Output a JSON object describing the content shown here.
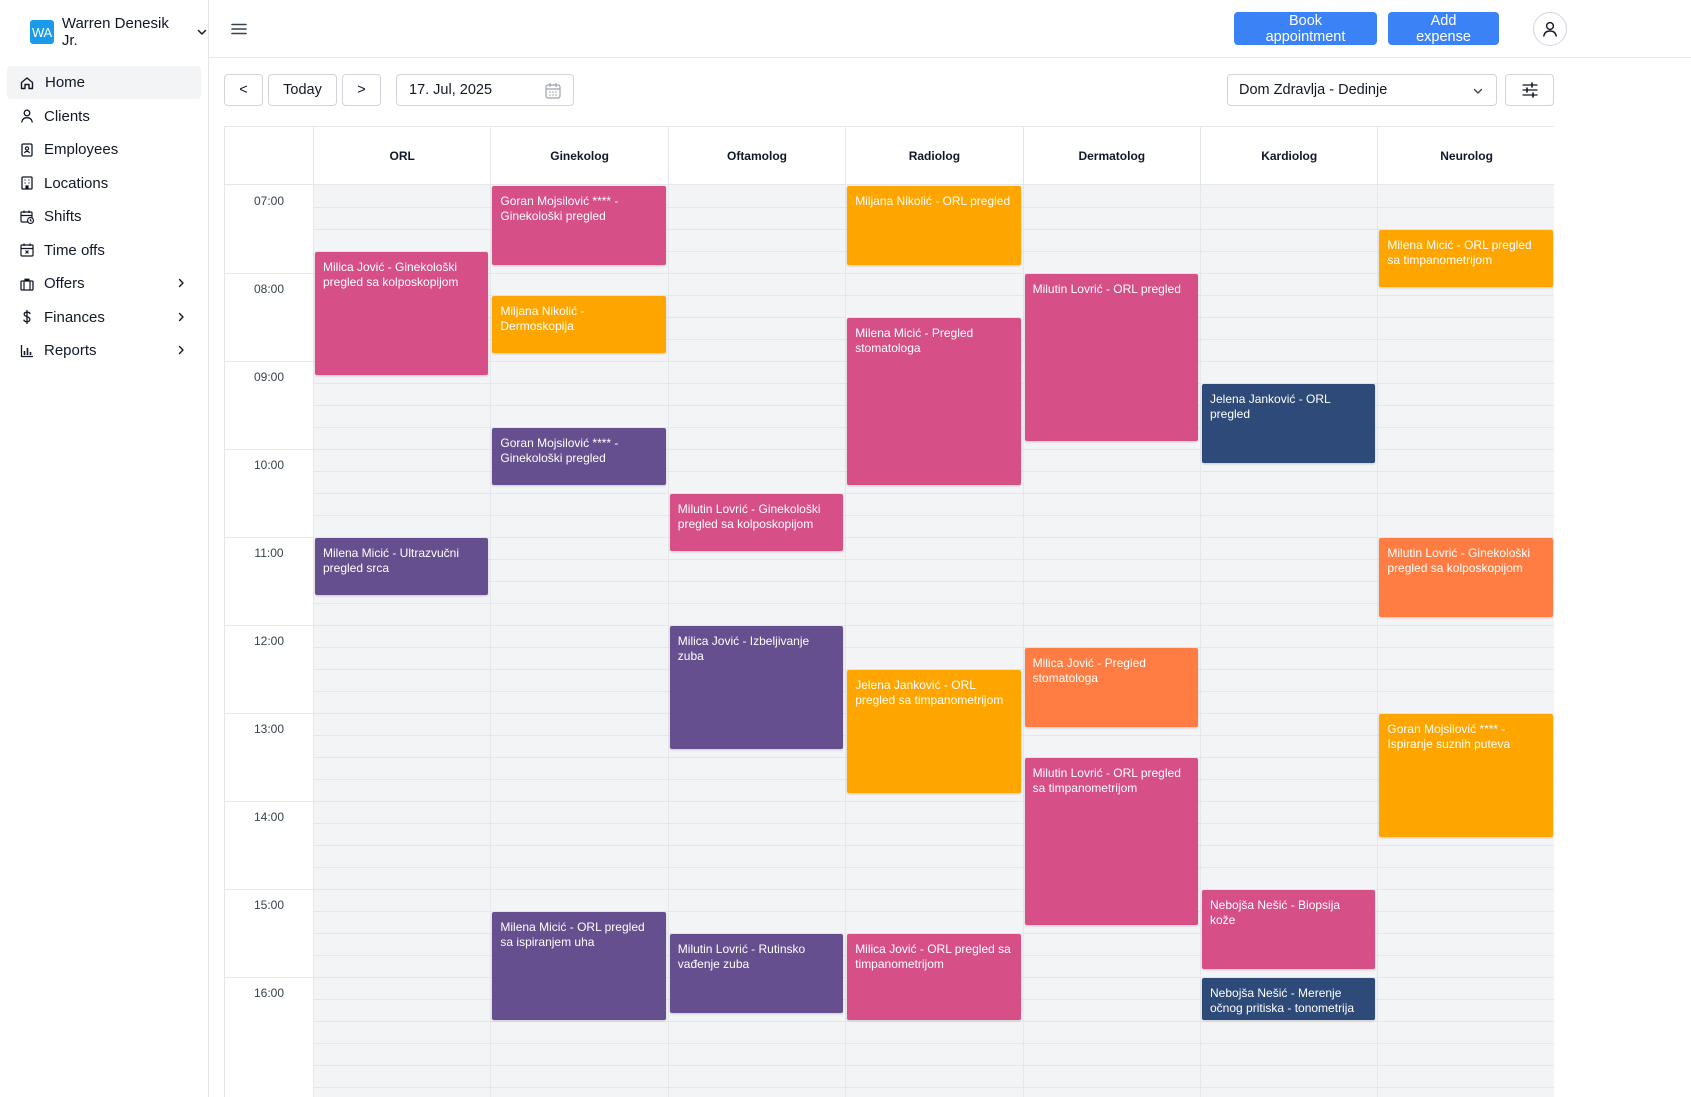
{
  "sidebar": {
    "user": {
      "initials": "WA",
      "name": "Warren Denesik Jr."
    },
    "items": [
      {
        "label": "Home",
        "icon": "home-icon",
        "active": true,
        "submenu": false
      },
      {
        "label": "Clients",
        "icon": "user-icon",
        "active": false,
        "submenu": false
      },
      {
        "label": "Employees",
        "icon": "id-badge-icon",
        "active": false,
        "submenu": false
      },
      {
        "label": "Locations",
        "icon": "building-icon",
        "active": false,
        "submenu": false
      },
      {
        "label": "Shifts",
        "icon": "calendar-clock-icon",
        "active": false,
        "submenu": false
      },
      {
        "label": "Time offs",
        "icon": "calendar-x-icon",
        "active": false,
        "submenu": false
      },
      {
        "label": "Offers",
        "icon": "briefcase-icon",
        "active": false,
        "submenu": true
      },
      {
        "label": "Finances",
        "icon": "dollar-icon",
        "active": false,
        "submenu": true
      },
      {
        "label": "Reports",
        "icon": "bar-chart-icon",
        "active": false,
        "submenu": true
      }
    ]
  },
  "header": {
    "book_label": "Book appointment",
    "expense_label": "Add expense"
  },
  "toolbar": {
    "prev_label": "<",
    "today_label": "Today",
    "next_label": ">",
    "date_value": "17. Jul, 2025",
    "location_value": "Dom Zdravlja - Dedinje"
  },
  "calendar": {
    "columns": [
      "ORL",
      "Ginekolog",
      "Oftamolog",
      "Radiolog",
      "Dermatolog",
      "Kardiolog",
      "Neurolog"
    ],
    "hours": [
      "07:00",
      "08:00",
      "09:00",
      "10:00",
      "11:00",
      "12:00",
      "13:00",
      "14:00",
      "15:00",
      "16:00"
    ],
    "day_start": "07:00",
    "colors": {
      "pink": "#d64f86",
      "orange": "#ffa500",
      "purple": "#654f8f",
      "navy": "#2d4a79",
      "coral": "#ff7d43"
    },
    "events": [
      {
        "col": 0,
        "start": "07:45",
        "end": "09:10",
        "title": "Milica Jović - Ginekološki pregled sa kolposkopijom",
        "color": "pink"
      },
      {
        "col": 0,
        "start": "11:00",
        "end": "11:40",
        "title": "Milena Micić - Ultrazvučni pregled srca",
        "color": "purple"
      },
      {
        "col": 1,
        "start": "07:00",
        "end": "07:55",
        "title": "Goran Mojsilović **** - Ginekološki pregled",
        "color": "pink"
      },
      {
        "col": 1,
        "start": "08:15",
        "end": "08:55",
        "title": "Miljana Nikolić - Dermoskopija",
        "color": "orange"
      },
      {
        "col": 1,
        "start": "09:45",
        "end": "10:25",
        "title": "Goran Mojsilović **** - Ginekološki pregled",
        "color": "purple"
      },
      {
        "col": 1,
        "start": "15:15",
        "end": "16:30",
        "title": "Milena Micić - ORL pregled sa ispiranjem uha",
        "color": "purple"
      },
      {
        "col": 2,
        "start": "10:30",
        "end": "11:10",
        "title": "Milutin Lovrić - Ginekološki pregled sa kolposkopijom",
        "color": "pink"
      },
      {
        "col": 2,
        "start": "12:00",
        "end": "13:25",
        "title": "Milica Jović - Izbeljivanje zuba",
        "color": "purple"
      },
      {
        "col": 2,
        "start": "15:30",
        "end": "16:25",
        "title": "Milutin Lovrić - Rutinsko vađenje zuba",
        "color": "purple"
      },
      {
        "col": 3,
        "start": "07:00",
        "end": "07:55",
        "title": "Miljana Nikolić - ORL pregled",
        "color": "orange"
      },
      {
        "col": 3,
        "start": "08:30",
        "end": "10:25",
        "title": "Milena Micić - Pregled stomatologa",
        "color": "pink"
      },
      {
        "col": 3,
        "start": "12:30",
        "end": "13:55",
        "title": "Jelena Janković - ORL pregled sa timpanometrijom",
        "color": "orange"
      },
      {
        "col": 3,
        "start": "15:30",
        "end": "16:30",
        "title": "Milica Jović - ORL pregled sa timpanometrijom",
        "color": "pink"
      },
      {
        "col": 4,
        "start": "08:00",
        "end": "09:55",
        "title": "Milutin Lovrić - ORL pregled",
        "color": "pink"
      },
      {
        "col": 4,
        "start": "12:15",
        "end": "13:10",
        "title": "Milica Jović - Pregled stomatologa",
        "color": "coral"
      },
      {
        "col": 4,
        "start": "13:30",
        "end": "15:25",
        "title": "Milutin Lovrić - ORL pregled sa timpanometrijom",
        "color": "pink"
      },
      {
        "col": 5,
        "start": "09:15",
        "end": "10:10",
        "title": "Jelena Janković - ORL pregled",
        "color": "navy"
      },
      {
        "col": 5,
        "start": "15:00",
        "end": "15:55",
        "title": "Nebojša Nešić - Biopsija kože",
        "color": "pink"
      },
      {
        "col": 5,
        "start": "16:00",
        "end": "16:30",
        "title": "Nebojša Nešić - Merenje očnog pritiska - tonometrija",
        "color": "navy"
      },
      {
        "col": 6,
        "start": "07:30",
        "end": "08:10",
        "title": "Milena Micić - ORL pregled sa timpanometrijom",
        "color": "orange"
      },
      {
        "col": 6,
        "start": "11:00",
        "end": "11:55",
        "title": "Milutin Lovrić - Ginekološki pregled sa kolposkopijom",
        "color": "coral"
      },
      {
        "col": 6,
        "start": "13:00",
        "end": "14:25",
        "title": "Goran Mojsilović **** - Ispiranje suznih puteva",
        "color": "orange"
      }
    ]
  }
}
